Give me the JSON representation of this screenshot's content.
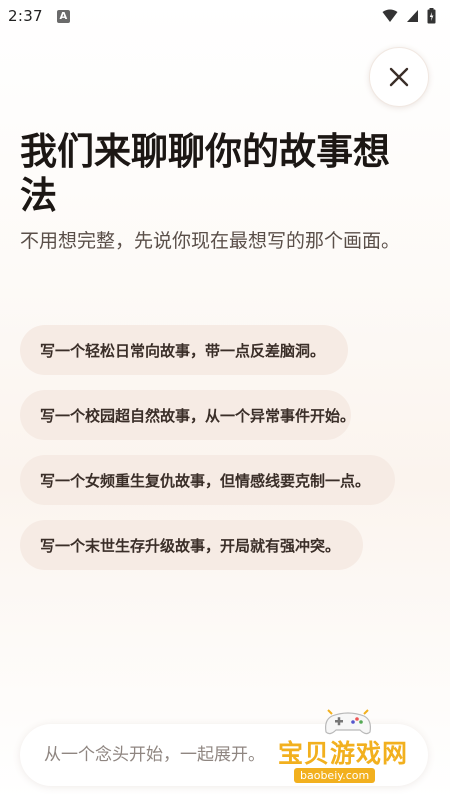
{
  "status_bar": {
    "time": "2:37",
    "app_icon_letter": "A"
  },
  "close_button": {
    "icon": "close-icon"
  },
  "header": {
    "title": "我们来聊聊你的故事想法",
    "subtitle": "不用想完整，先说你现在最想写的那个画面。"
  },
  "suggestions": [
    "写一个轻松日常向故事，带一点反差脑洞。",
    "写一个校园超自然故事，从一个异常事件开始。",
    "写一个女频重生复仇故事，但情感线要克制一点。",
    "写一个末世生存升级故事，开局就有强冲突。"
  ],
  "input": {
    "placeholder": "从一个念头开始，一起展开。"
  },
  "watermark": {
    "text": "宝贝游戏网",
    "url": "baobeiy.com"
  },
  "colors": {
    "chip_background": "#f6ebe4",
    "accent_watermark": "#f2b01e"
  }
}
